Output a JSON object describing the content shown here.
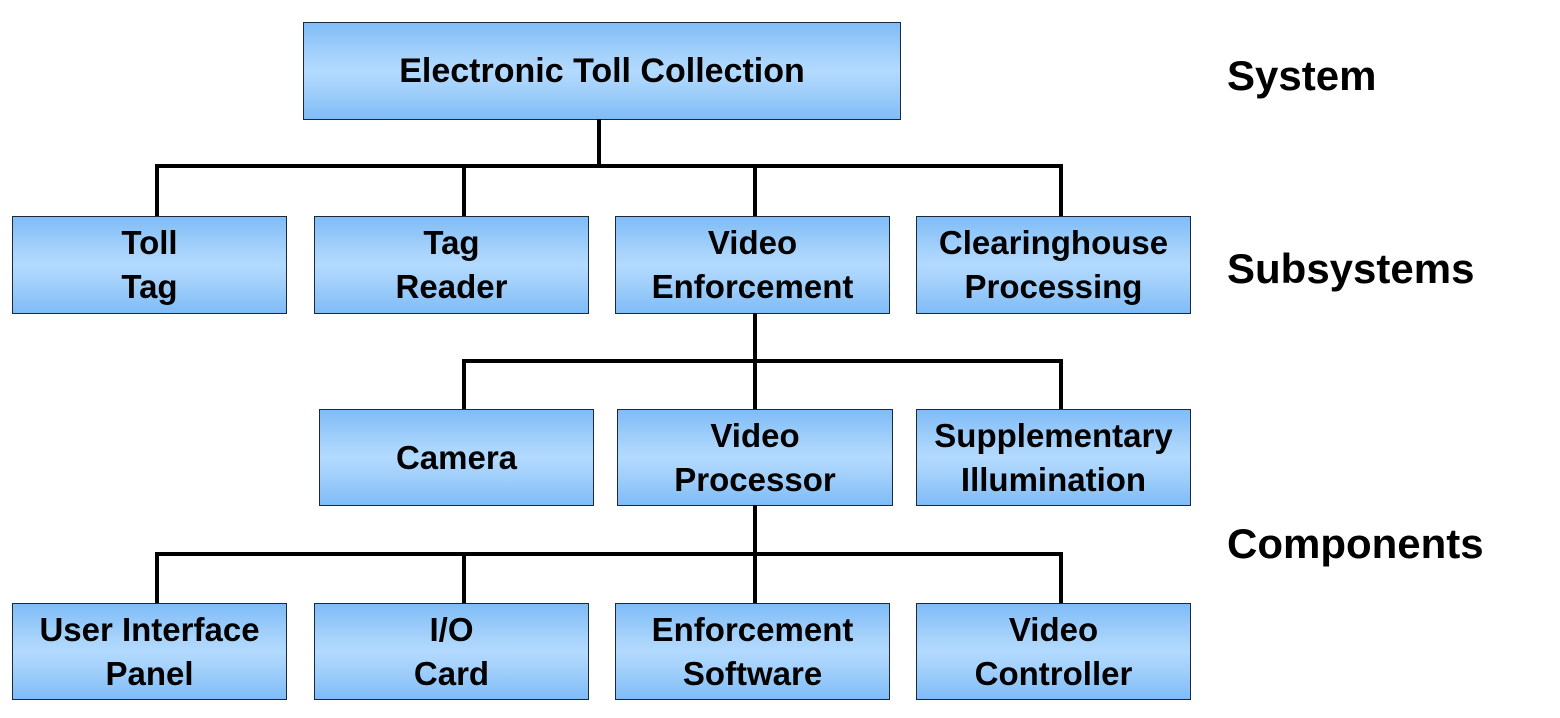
{
  "diagram": {
    "root": {
      "label": "Electronic Toll Collection"
    },
    "subsystems": [
      {
        "label": "Toll\nTag"
      },
      {
        "label": "Tag\nReader"
      },
      {
        "label": "Video\nEnforcement"
      },
      {
        "label": "Clearinghouse\nProcessing"
      }
    ],
    "video_enforcement_children": [
      {
        "label": "Camera"
      },
      {
        "label": "Video\nProcessor"
      },
      {
        "label": "Supplementary\nIllumination"
      }
    ],
    "video_processor_children": [
      {
        "label": "User Interface\nPanel"
      },
      {
        "label": "I/O\nCard"
      },
      {
        "label": "Enforcement\nSoftware"
      },
      {
        "label": "Video\nController"
      }
    ],
    "levels": {
      "system": "System",
      "subsystems": "Subsystems",
      "components": "Components"
    },
    "colors": {
      "box_fill_edge": "#7fbcf7",
      "box_fill_center": "#b3daff",
      "box_border": "#1a2a3a",
      "connector": "#000000"
    }
  }
}
